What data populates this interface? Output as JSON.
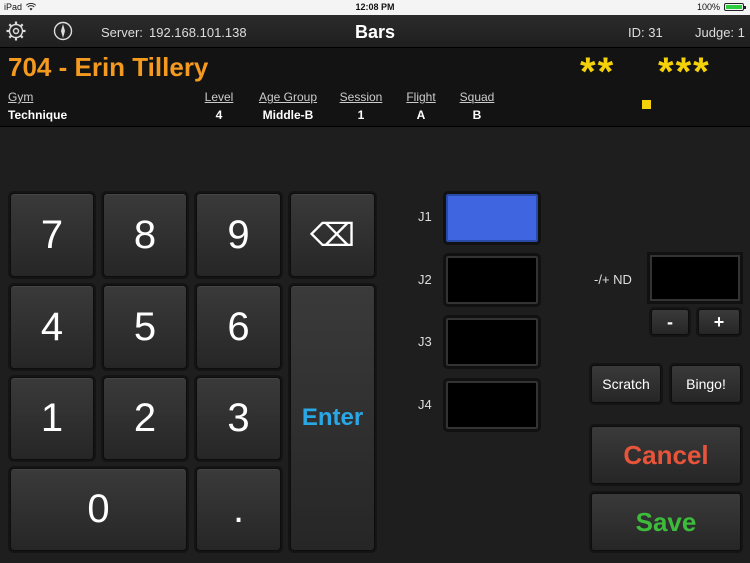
{
  "status_bar": {
    "device": "iPad",
    "time": "12:08 PM",
    "battery": "100%",
    "battery_level": 1.0
  },
  "toolbar": {
    "server_label": "Server:",
    "server_value": "192.168.101.138",
    "title": "Bars",
    "id_text": "ID:  31",
    "judge_text": "Judge: 1"
  },
  "athlete": {
    "name": "704 - Erin Tillery",
    "stars_left": "**",
    "stars_right": "***",
    "gym_header": "Gym",
    "gym_value": "Technique",
    "level_header": "Level",
    "level_value": "4",
    "age_group_header": "Age Group",
    "age_group_value": "Middle-B",
    "session_header": "Session",
    "session_value": "1",
    "flight_header": "Flight",
    "flight_value": "A",
    "squad_header": "Squad",
    "squad_value": "B"
  },
  "keypad": {
    "k7": "7",
    "k8": "8",
    "k9": "9",
    "backspace": "⌫",
    "k4": "4",
    "k5": "5",
    "k6": "6",
    "enter": "Enter",
    "k1": "1",
    "k2": "2",
    "k3": "3",
    "k0": "0",
    "dot": "."
  },
  "judges": {
    "j1": "J1",
    "j2": "J2",
    "j3": "J3",
    "j4": "J4"
  },
  "nd": {
    "label": "-/+ ND",
    "minus": "-",
    "plus": "+"
  },
  "actions": {
    "scratch": "Scratch",
    "bingo": "Bingo!",
    "cancel": "Cancel",
    "save": "Save"
  },
  "colors": {
    "name_orange": "#f39a1f",
    "stars_yellow": "#f5d10a",
    "enter_blue": "#2aa8e6",
    "j1_active": "#3f66e0",
    "cancel_red": "#e8543a",
    "save_green": "#3dbb3a"
  }
}
